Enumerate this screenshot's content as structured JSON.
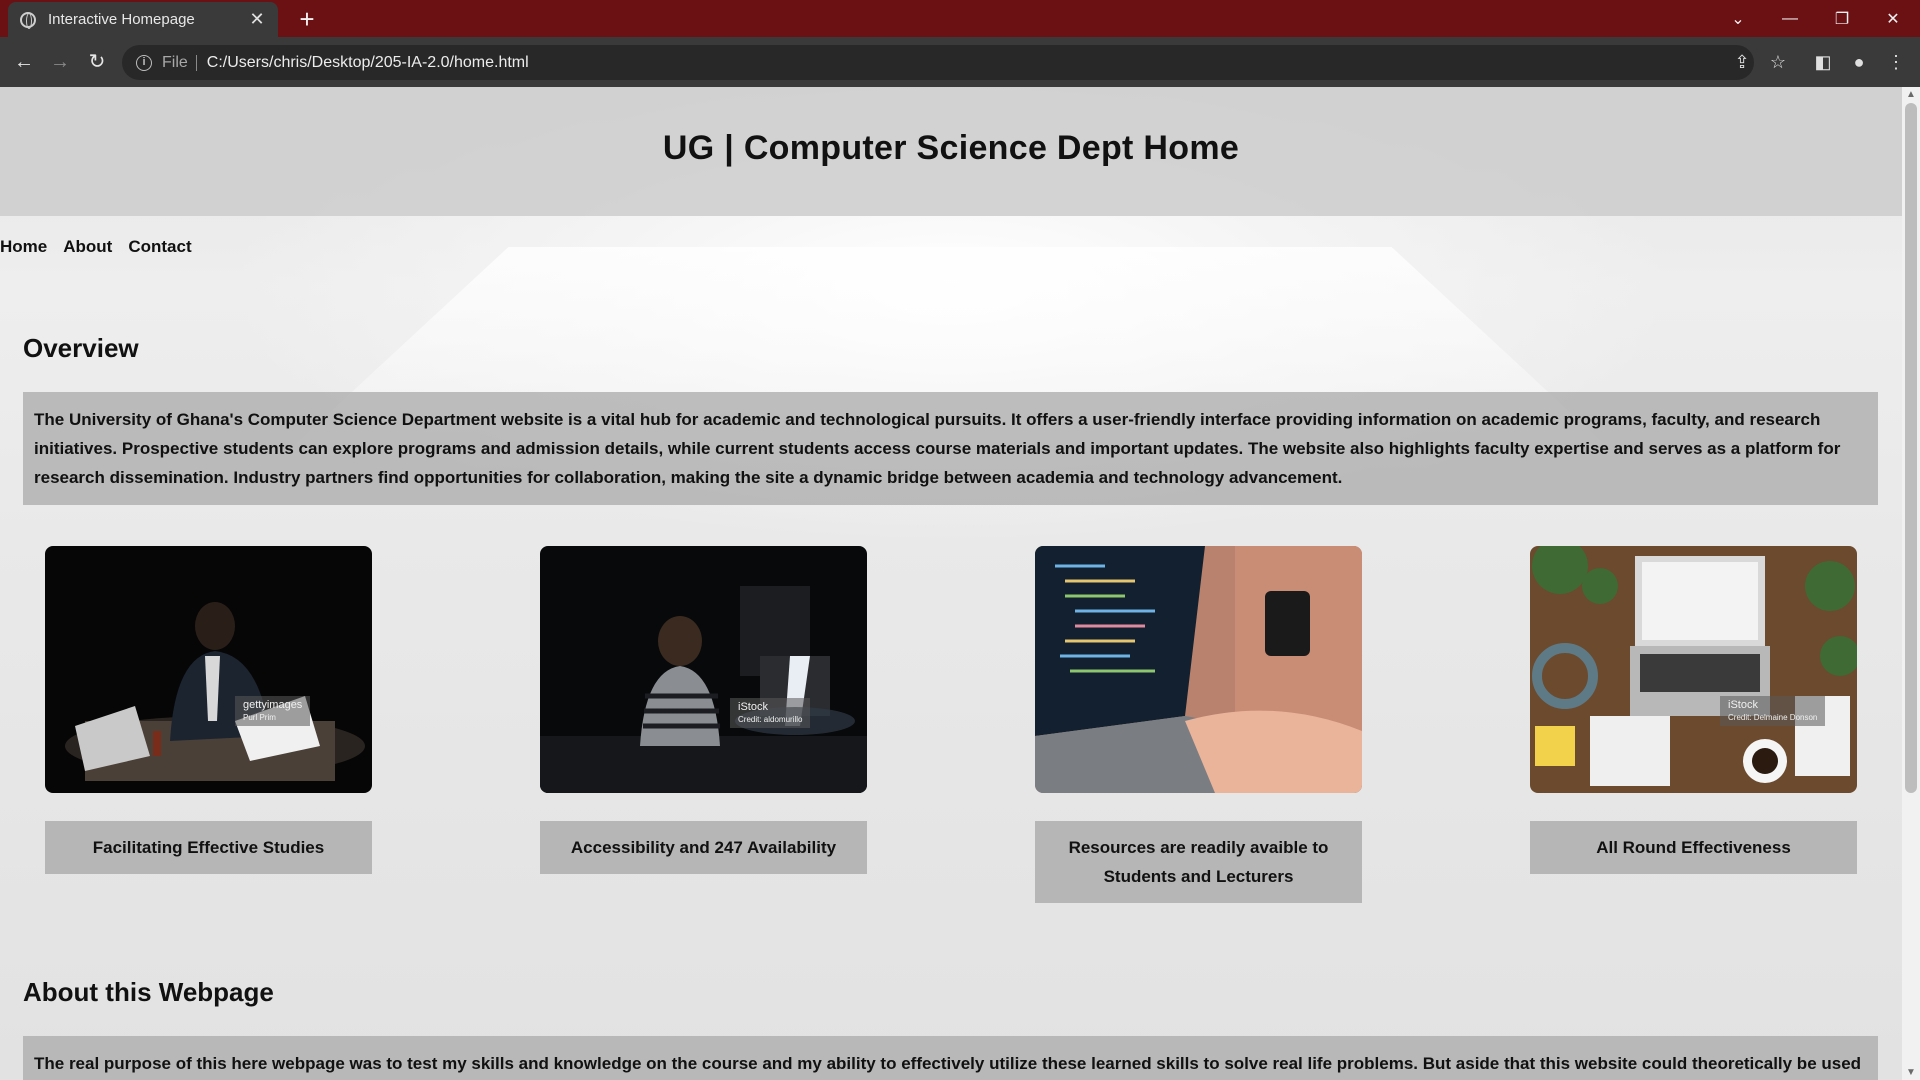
{
  "browser": {
    "tab_title": "Interactive Homepage",
    "url_scheme": "File",
    "url": "C:/Users/chris/Desktop/205-IA-2.0/home.html"
  },
  "page": {
    "title": "UG | Computer Science Dept Home",
    "nav": [
      "Home",
      "About",
      "Contact"
    ],
    "overview": {
      "heading": "Overview",
      "text": "The University of Ghana's Computer Science Department website is a vital hub for academic and technological pursuits. It offers a user-friendly interface providing information on academic programs, faculty, and research initiatives. Prospective students can explore programs and admission details, while current students access course materials and important updates. The website also highlights faculty expertise and serves as a platform for research dissemination. Industry partners find opportunities for collaboration, making the site a dynamic bridge between academia and technology advancement."
    },
    "cards": [
      {
        "caption": "Facilitating Effective Studies",
        "watermark": "gettyimages",
        "watermark_sub": "Purl Prim"
      },
      {
        "caption": "Accessibility and 247 Availability",
        "watermark": "iStock",
        "watermark_sub": "Credit: aldomurillo"
      },
      {
        "caption": "Resources are readily avaible to Students and Lecturers",
        "watermark": "",
        "watermark_sub": ""
      },
      {
        "caption": "All Round Effectiveness",
        "watermark": "iStock",
        "watermark_sub": "Credit: Delmaine Donson"
      }
    ],
    "about": {
      "heading": "About this Webpage",
      "text": "The real purpose of this here webpage was to test my skills and knowledge on the course and my ability to effectively utilize these learned skills to solve real life problems. But aside that this website could theoretically be used to"
    }
  }
}
